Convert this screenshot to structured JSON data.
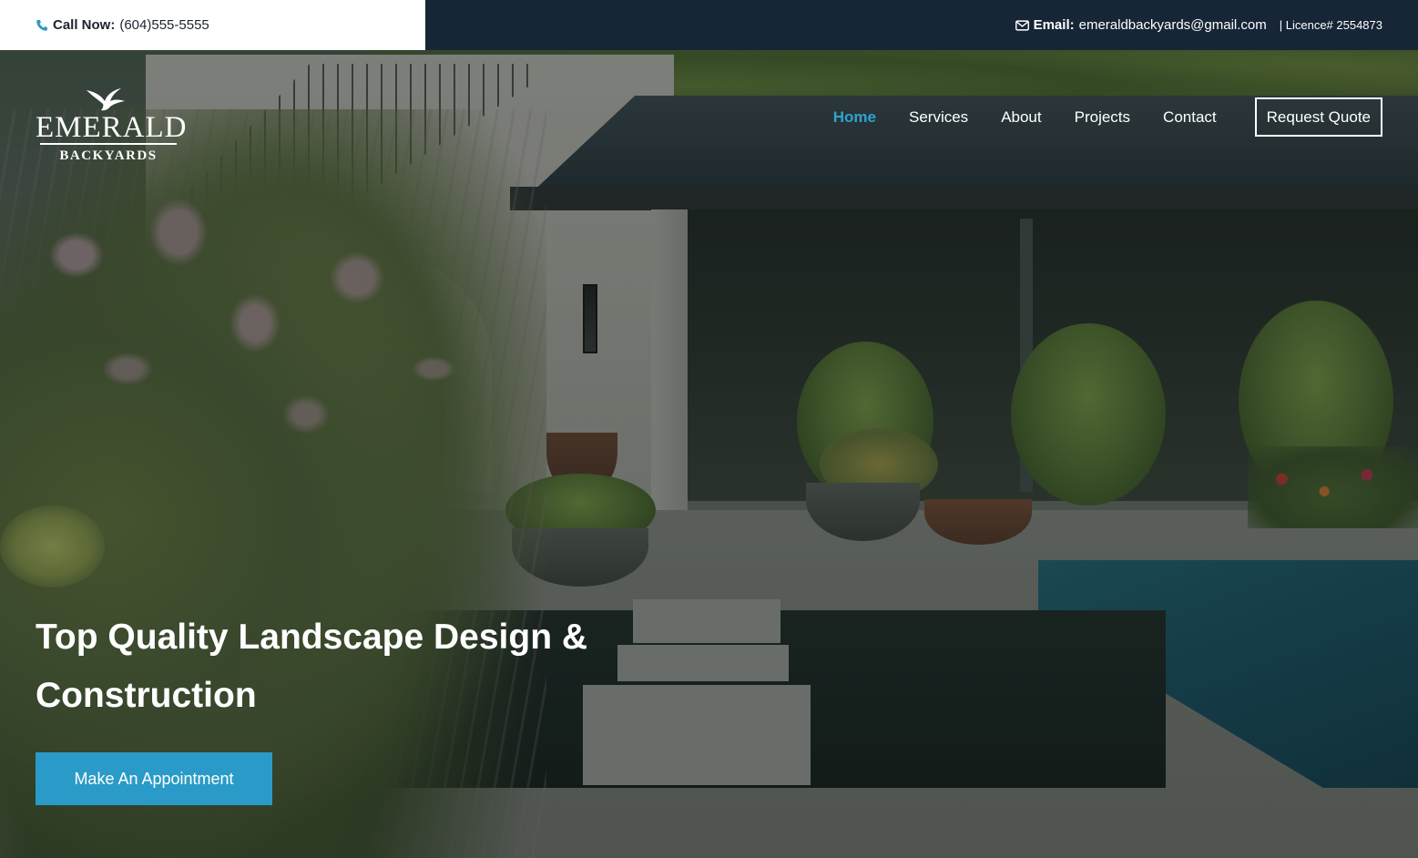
{
  "topbar": {
    "call_label": "Call Now:",
    "phone": "(604)555-5555",
    "email_label": "Email:",
    "email": "emeraldbackyards@gmail.com",
    "licence": "| Licence# 2554873",
    "icons": {
      "phone": "phone-icon",
      "email": "envelope-icon"
    },
    "colors": {
      "left_bg": "#ffffff",
      "right_bg": "#172636",
      "icon_accent": "#2a9bc8"
    }
  },
  "logo": {
    "brand": "EMERALD",
    "sub": "BACKYARDS",
    "icon": "bird-icon"
  },
  "nav": {
    "items": [
      {
        "label": "Home",
        "active": true
      },
      {
        "label": "Services",
        "active": false
      },
      {
        "label": "About",
        "active": false
      },
      {
        "label": "Projects",
        "active": false
      },
      {
        "label": "Contact",
        "active": false
      }
    ],
    "quote_label": "Request Quote",
    "active_color": "#2ea3cf"
  },
  "hero": {
    "title_line1": "Top Quality Landscape Design &",
    "title_line2": "Construction",
    "cta_label": "Make An Appointment",
    "cta_color": "#2a9bc8"
  }
}
